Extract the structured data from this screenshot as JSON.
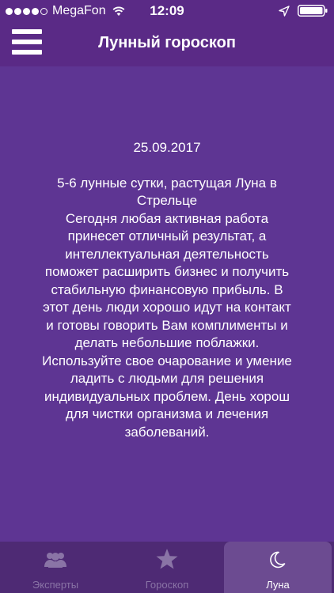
{
  "status_bar": {
    "carrier": "MegaFon",
    "time": "12:09",
    "signal_bars": 4,
    "icons": [
      "signal-icon",
      "wifi-icon",
      "location-icon",
      "battery-icon"
    ]
  },
  "header": {
    "title": "Лунный гороскоп",
    "menu_icon": "hamburger-menu-icon"
  },
  "content": {
    "date": "25.09.2017",
    "text": "5-6 лунные сутки, растущая Луна в\nСтрельце\nСегодня любая активная работа\nпринесет отличный результат, а\nинтеллектуальная деятельность\nпоможет расширить бизнес и получить\nстабильную финансовую прибыль. В\nэтот день люди хорошо идут на контакт\nи готовы говорить Вам комплименты и\nделать небольшие поблажки.\nИспользуйте свое очарование и умение\nладить с людьми для решения\nиндивидуальных проблем. День хорош\nдля чистки организма и лечения\nзаболеваний."
  },
  "tabs": [
    {
      "label": "Эксперты",
      "icon": "experts-icon",
      "active": false
    },
    {
      "label": "Гороскоп",
      "icon": "star-icon",
      "active": false
    },
    {
      "label": "Луна",
      "icon": "moon-icon",
      "active": true
    }
  ],
  "colors": {
    "header": "#5a2a86",
    "background": "#5e3593",
    "tabbar": "#4e2a74",
    "active_tab": "#6c4b91",
    "inactive_label": "#8a74a6"
  }
}
